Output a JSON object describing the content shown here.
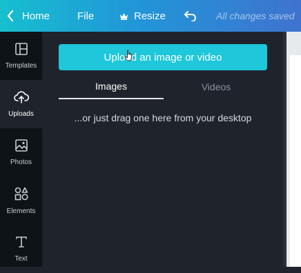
{
  "topbar": {
    "home_label": "Home",
    "file_label": "File",
    "resize_label": "Resize",
    "status_text": "All changes saved"
  },
  "rail": {
    "items": [
      {
        "label": "Templates",
        "icon": "templates-icon"
      },
      {
        "label": "Uploads",
        "icon": "upload-cloud-icon"
      },
      {
        "label": "Photos",
        "icon": "photos-icon"
      },
      {
        "label": "Elements",
        "icon": "elements-icon"
      },
      {
        "label": "Text",
        "icon": "text-icon"
      }
    ],
    "active": "Uploads"
  },
  "panel": {
    "upload_button_label": "Upload an image or video",
    "tabs": [
      {
        "label": "Images",
        "active": true
      },
      {
        "label": "Videos",
        "active": false
      }
    ],
    "hint": "...or just drag one here from your desktop"
  },
  "colors": {
    "accent": "#1ec7d9",
    "topbar_start": "#17bfcf",
    "topbar_end": "#3f73cf",
    "panel_bg": "#1f242c",
    "rail_bg": "#0e1318"
  }
}
